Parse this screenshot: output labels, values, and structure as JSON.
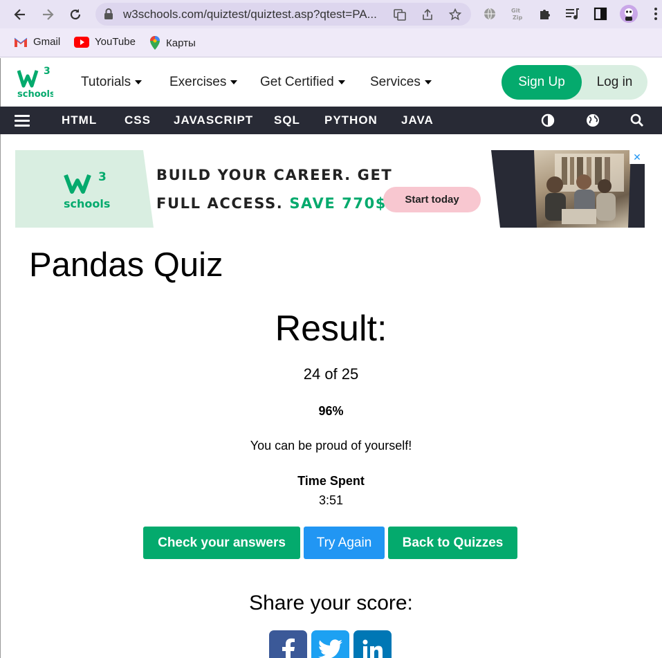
{
  "browser": {
    "url": "w3schools.com/quiztest/quiztest.asp?qtest=PA...",
    "bookmarks": [
      {
        "label": "Gmail",
        "icon": "gmail-icon"
      },
      {
        "label": "YouTube",
        "icon": "youtube-icon"
      },
      {
        "label": "Карты",
        "icon": "maps-icon"
      }
    ]
  },
  "header": {
    "menu": [
      {
        "label": "Tutorials"
      },
      {
        "label": "Exercises"
      },
      {
        "label": "Get Certified"
      },
      {
        "label": "Services"
      }
    ],
    "signup_label": "Sign Up",
    "login_label": "Log in"
  },
  "topnav": {
    "items": [
      "HTML",
      "CSS",
      "JAVASCRIPT",
      "SQL",
      "PYTHON",
      "JAVA"
    ]
  },
  "ad": {
    "logo_text": "schools",
    "line1": "BUILD YOUR CAREER. GET",
    "line2": "FULL ACCESS.",
    "line2_highlight": "SAVE 770$",
    "cta": "Start today",
    "close": "✕"
  },
  "main": {
    "title": "Pandas Quiz",
    "result_heading": "Result:",
    "score": "24 of 25",
    "percent": "96%",
    "message": "You can be proud of yourself!",
    "time_label": "Time Spent",
    "time_value": "3:51",
    "buttons": {
      "check": "Check your answers",
      "retry": "Try Again",
      "back": "Back to Quizzes"
    },
    "share_heading": "Share your score:"
  },
  "colors": {
    "brand_green": "#04aa6d",
    "nav_dark": "#282a35",
    "button_blue": "#2196f3",
    "facebook": "#3b5998",
    "twitter": "#1da1f2",
    "linkedin": "#0077b5"
  }
}
